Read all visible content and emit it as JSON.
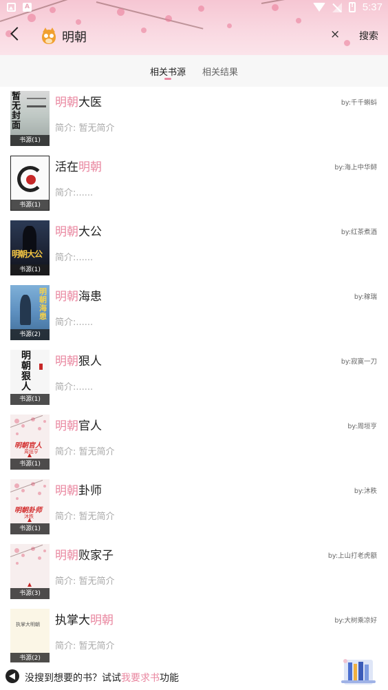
{
  "status_bar": {
    "time": "5:37"
  },
  "header": {
    "query": "明朝",
    "clear_label": "×",
    "search_label": "搜索"
  },
  "tabs": [
    {
      "label": "相关书源",
      "active": true
    },
    {
      "label": "相关结果",
      "active": false
    }
  ],
  "colors": {
    "accent": "#e9869f",
    "header_bg": "#f6c6d3"
  },
  "books": [
    {
      "title_parts": [
        [
          "明朝",
          true
        ],
        [
          "大医",
          false
        ]
      ],
      "author": "by:千千蝌蚪",
      "intro": "简介: 暂无简介",
      "source": "书源(1)",
      "cover": "placeholder-cover",
      "cover_text": "暂无封面"
    },
    {
      "title_parts": [
        [
          "活在",
          false
        ],
        [
          "明朝",
          true
        ]
      ],
      "author": "by:海上中华鲟",
      "intro": "简介:......",
      "source": "书源(1)",
      "cover": "ink-circle-cover",
      "cover_text": ""
    },
    {
      "title_parts": [
        [
          "明朝",
          true
        ],
        [
          "大公",
          false
        ]
      ],
      "author": "by:红茶煮酒",
      "intro": "简介:......",
      "source": "书源(1)",
      "cover": "warrior-cover",
      "cover_text": "明朝大公"
    },
    {
      "title_parts": [
        [
          "明朝",
          true
        ],
        [
          "海患",
          false
        ]
      ],
      "author": "by:稼瑞",
      "intro": "简介:......",
      "source": "书源(2)",
      "cover": "sea-cover",
      "cover_text": "明朝海患"
    },
    {
      "title_parts": [
        [
          "明朝",
          true
        ],
        [
          "狠人",
          false
        ]
      ],
      "author": "by:寂寞一刀",
      "intro": "简介:......",
      "source": "书源(1)",
      "cover": "calligraphy-cover",
      "cover_text": "明朝狠人"
    },
    {
      "title_parts": [
        [
          "明朝",
          true
        ],
        [
          "官人",
          false
        ]
      ],
      "author": "by:周垣亨",
      "intro": "简介: 暂无简介",
      "source": "书源(1)",
      "cover": "blossom-cover",
      "cover_text": "明朝官人",
      "cover_subtext": "周垣亨"
    },
    {
      "title_parts": [
        [
          "明朝",
          true
        ],
        [
          "卦师",
          false
        ]
      ],
      "author": "by:沐秩",
      "intro": "简介: 暂无简介",
      "source": "书源(1)",
      "cover": "blossom-cover",
      "cover_text": "明朝卦师",
      "cover_subtext": "沐秩"
    },
    {
      "title_parts": [
        [
          "明朝",
          true
        ],
        [
          "败家子",
          false
        ]
      ],
      "author": "by:上山打老虎额",
      "intro": "简介: 暂无简介",
      "source": "书源(3)",
      "cover": "blossom-cover",
      "cover_text": "",
      "cover_subtext": ""
    },
    {
      "title_parts": [
        [
          "执掌大",
          false
        ],
        [
          "明朝",
          true
        ]
      ],
      "author": "by:大树乘凉好",
      "intro": "简介: 暂无简介",
      "source": "书源(2)",
      "cover": "plain-cover",
      "cover_text": "执掌大明朝"
    }
  ],
  "bottom_tip": {
    "prefix": "没搜到想要的书？试试",
    "link": "我要求书",
    "suffix": "功能"
  }
}
